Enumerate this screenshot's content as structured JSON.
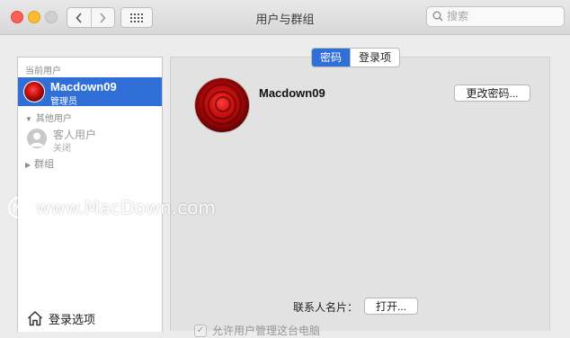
{
  "window": {
    "title": "用户与群组"
  },
  "toolbar": {
    "back_icon": "chevron-left-icon",
    "forward_icon": "chevron-right-icon",
    "grid_icon": "grid-icon",
    "search_placeholder": "搜索"
  },
  "sidebar": {
    "current_users_label": "当前用户",
    "selected_user": {
      "name": "Macdown09",
      "role": "管理员"
    },
    "other_users_label": "其他用户",
    "guest_user": {
      "name": "客人用户",
      "status": "关闭"
    },
    "groups_label": "群组",
    "login_options_label": "登录选项"
  },
  "tabs": {
    "password": "密码",
    "login_items": "登录项"
  },
  "main": {
    "username": "Macdown09",
    "change_password_button": "更改密码...",
    "contact_card_label": "联系人名片：",
    "open_button": "打开...",
    "allow_admin_label": "允许用户管理这台电脑"
  },
  "watermark": "www.MacDown.com",
  "colors": {
    "accent": "#2f6fd7",
    "close": "#fc5f57",
    "minimize": "#fdbc2e",
    "zoom": "#cfcfcf"
  }
}
